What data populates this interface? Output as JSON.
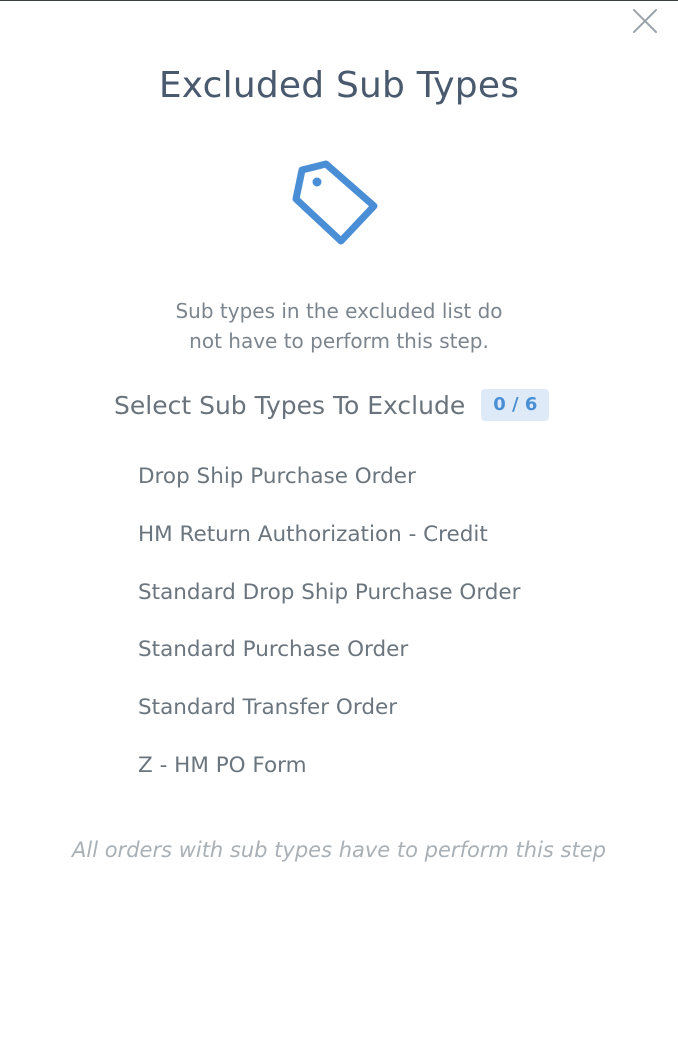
{
  "modal": {
    "title": "Excluded Sub Types",
    "close_icon": "close-icon",
    "header_icon": "tag-icon"
  },
  "description": {
    "line1": "Sub types in the excluded list do",
    "line2": "not have to perform this step."
  },
  "selection": {
    "heading": "Select Sub Types To Exclude",
    "count": "0 / 6",
    "items": [
      {
        "label": "Drop Ship Purchase Order"
      },
      {
        "label": "HM Return Authorization - Credit"
      },
      {
        "label": "Standard Drop Ship Purchase Order"
      },
      {
        "label": "Standard Purchase Order"
      },
      {
        "label": "Standard Transfer Order"
      },
      {
        "label": "Z - HM PO Form"
      }
    ]
  },
  "footer": {
    "note": "All orders with sub types have to perform this step"
  },
  "colors": {
    "accent": "#4a8fd6",
    "badge_bg": "#deeaf8",
    "title": "#4a5a6e",
    "muted": "#a9b0b6"
  }
}
